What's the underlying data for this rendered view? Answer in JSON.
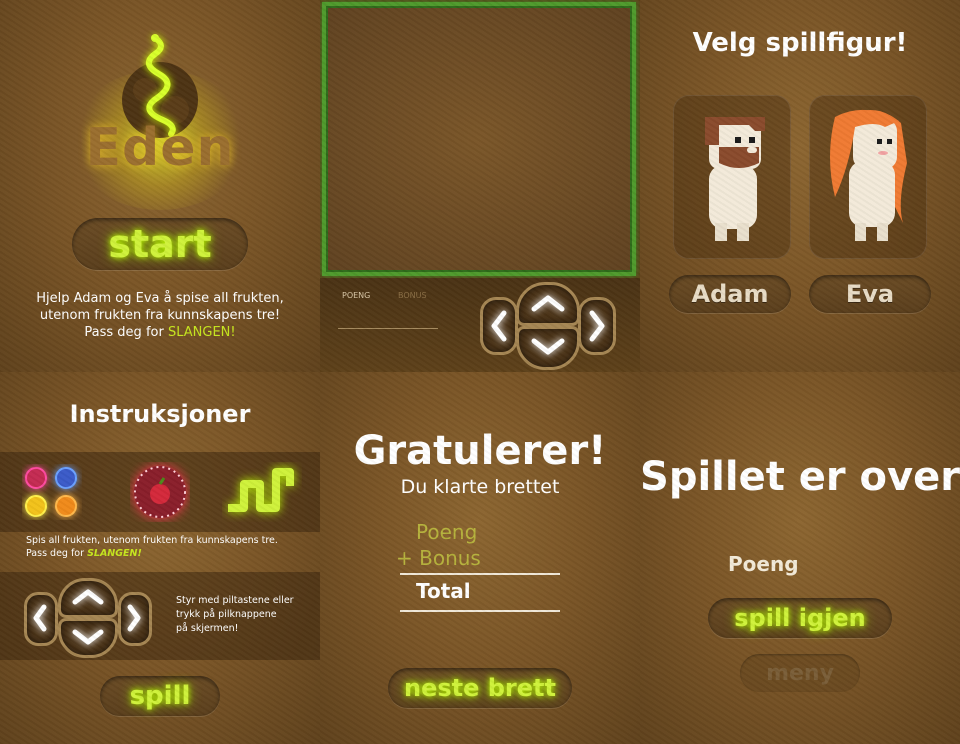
{
  "screen1": {
    "logo_text": "Eden",
    "start_label": "start",
    "intro_line1": "Hjelp Adam og Eva å spise all frukten,",
    "intro_line2": "utenom frukten fra kunnskapens tre!",
    "intro_line3_prefix": "Pass deg for ",
    "intro_line3_highlight": "SLANGEN!"
  },
  "screen2": {
    "score_label": "POENG",
    "bonus_label": "BONUS"
  },
  "screen3": {
    "title": "Velg spillfigur!",
    "adam_label": "Adam",
    "eva_label": "Eva"
  },
  "screen4": {
    "title": "Instruksjoner",
    "rule_line1": "Spis all frukten, utenom frukten fra kunnskapens tre.",
    "rule_line2_prefix": "Pass deg for ",
    "rule_line2_highlight": "SLANGEN!",
    "controls_line1": "Styr med piltastene eller",
    "controls_line2": "trykk på pilknappene",
    "controls_line3": "på skjermen!",
    "play_label": "spill"
  },
  "screen5": {
    "title": "Gratulerer!",
    "subtitle": "Du klarte brettet",
    "score_label": "Poeng",
    "bonus_label": "+ Bonus",
    "total_label": "Total",
    "next_label": "neste brett"
  },
  "screen6": {
    "title": "Spillet er over",
    "score_label": "Poeng",
    "replay_label": "spill igjen",
    "menu_label": "meny"
  },
  "colors": {
    "glow_green": "#cff23a",
    "highlight_green": "#c6e61e",
    "olive_text": "#b6b23c",
    "background_brown": "#7a5526"
  }
}
